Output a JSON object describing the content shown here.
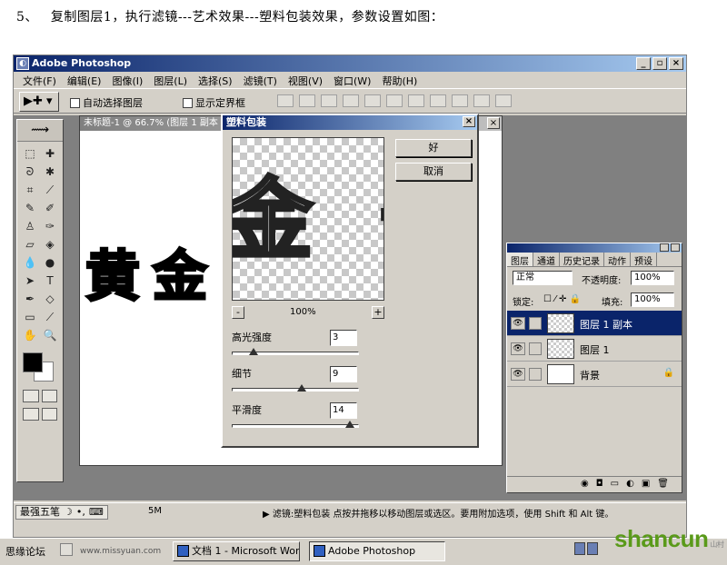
{
  "instruction": {
    "number": "5、",
    "text": "复制图层1，执行滤镜---艺术效果---塑料包装效果，参数设置如图："
  },
  "app": {
    "title": "Adobe Photoshop",
    "menu": [
      "文件(F)",
      "编辑(E)",
      "图像(I)",
      "图层(L)",
      "选择(S)",
      "滤镜(T)",
      "视图(V)",
      "窗口(W)",
      "帮助(H)"
    ],
    "window_buttons": [
      "_",
      "▫",
      "×"
    ]
  },
  "options": {
    "auto_select": "自动选择图层",
    "show_bounds": "显示定界框"
  },
  "document": {
    "title": "未标题-1 @ 66.7% (图层 1 副本",
    "canvas_text": "黄金"
  },
  "dialog": {
    "title": "塑料包装",
    "preview_text": "金 于",
    "zoom": "100%",
    "zoom_minus": "-",
    "zoom_plus": "+",
    "ok": "好",
    "cancel": "取消",
    "params": [
      {
        "label": "高光强度",
        "value": "3",
        "fraction": 0.17
      },
      {
        "label": "细节",
        "value": "9",
        "fraction": 0.55
      },
      {
        "label": "平滑度",
        "value": "14",
        "fraction": 0.93
      }
    ]
  },
  "layers_panel": {
    "tabs": [
      "图层",
      "通道",
      "历史记录",
      "动作",
      "预设"
    ],
    "blend_mode": "正常",
    "opacity_label": "不透明度:",
    "opacity": "100%",
    "lock_label": "锁定:",
    "fill_label": "填充:",
    "fill": "100%",
    "layers": [
      {
        "name": "图层 1 副本",
        "selected": true,
        "thumb": "checker"
      },
      {
        "name": "图层 1",
        "selected": false,
        "thumb": "checker"
      },
      {
        "name": "背景",
        "selected": false,
        "thumb": "white"
      }
    ]
  },
  "status": {
    "ime": "最强五笔",
    "doc_size": "5M",
    "message": "▶ 滤镜:塑料包装   点按并拖移以移动图层或选区。要用附加选项，使用 Shift 和 Alt 键。"
  },
  "taskbar": {
    "left_label": "思缘论坛",
    "url": "www.missyuan.com",
    "tasks": [
      "文档 1 - Microsoft Word",
      "Adobe Photoshop"
    ],
    "brand": "shancun",
    "brand_sub": "山村网 .net"
  }
}
